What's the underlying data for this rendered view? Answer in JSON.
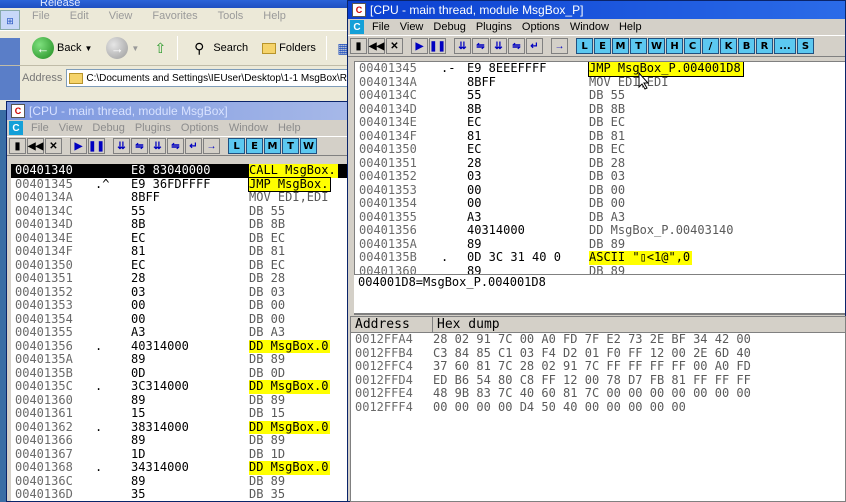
{
  "explorer": {
    "title": "Release",
    "menu": [
      "File",
      "Edit",
      "View",
      "Favorites",
      "Tools",
      "Help"
    ],
    "back_label": "Back",
    "search_label": "Search",
    "folders_label": "Folders",
    "address_label": "Address",
    "address_value": "C:\\Documents and Settings\\IEUser\\Desktop\\1-1 MsgBox\\Re"
  },
  "olly_left": {
    "title": "[CPU - main thread, module MsgBox]",
    "menu": [
      "File",
      "View",
      "Debug",
      "Plugins",
      "Options",
      "Window",
      "Help"
    ],
    "toolbar_letters": [
      "L",
      "E",
      "M",
      "T",
      "W"
    ],
    "rows": [
      {
        "addr": "00401340",
        "sym": "$",
        "hex": "E8 83040000",
        "mnem": "CALL MsgBox.",
        "sel": true,
        "hl": true
      },
      {
        "addr": "00401345",
        "sym": ".^",
        "hex": "E9 36FDFFFF",
        "mnem": "JMP MsgBox.",
        "box": true,
        "hl": true
      },
      {
        "addr": "0040134A",
        "sym": "",
        "hex": "8BFF",
        "mnem": "MOV EDI,EDI"
      },
      {
        "addr": "0040134C",
        "sym": "",
        "hex": "55",
        "mnem": "DB 55"
      },
      {
        "addr": "0040134D",
        "sym": "",
        "hex": "8B",
        "mnem": "DB 8B"
      },
      {
        "addr": "0040134E",
        "sym": "",
        "hex": "EC",
        "mnem": "DB EC"
      },
      {
        "addr": "0040134F",
        "sym": "",
        "hex": "81",
        "mnem": "DB 81"
      },
      {
        "addr": "00401350",
        "sym": "",
        "hex": "EC",
        "mnem": "DB EC"
      },
      {
        "addr": "00401351",
        "sym": "",
        "hex": "28",
        "mnem": "DB 28"
      },
      {
        "addr": "00401352",
        "sym": "",
        "hex": "03",
        "mnem": "DB 03"
      },
      {
        "addr": "00401353",
        "sym": "",
        "hex": "00",
        "mnem": "DB 00"
      },
      {
        "addr": "00401354",
        "sym": "",
        "hex": "00",
        "mnem": "DB 00"
      },
      {
        "addr": "00401355",
        "sym": "",
        "hex": "A3",
        "mnem": "DB A3"
      },
      {
        "addr": "00401356",
        "sym": ".",
        "hex": "40314000",
        "mnem": "DD MsgBox.0",
        "hl": true
      },
      {
        "addr": "0040135A",
        "sym": "",
        "hex": "89",
        "mnem": "DB 89"
      },
      {
        "addr": "0040135B",
        "sym": "",
        "hex": "0D",
        "mnem": "DB 0D"
      },
      {
        "addr": "0040135C",
        "sym": ".",
        "hex": "3C314000",
        "mnem": "DD MsgBox.0",
        "hl": true
      },
      {
        "addr": "00401360",
        "sym": "",
        "hex": "89",
        "mnem": "DB 89"
      },
      {
        "addr": "00401361",
        "sym": "",
        "hex": "15",
        "mnem": "DB 15"
      },
      {
        "addr": "00401362",
        "sym": ".",
        "hex": "38314000",
        "mnem": "DD MsgBox.0",
        "hl": true
      },
      {
        "addr": "00401366",
        "sym": "",
        "hex": "89",
        "mnem": "DB 89"
      },
      {
        "addr": "00401367",
        "sym": "",
        "hex": "1D",
        "mnem": "DB 1D"
      },
      {
        "addr": "00401368",
        "sym": ".",
        "hex": "34314000",
        "mnem": "DD MsgBox.0",
        "hl": true
      },
      {
        "addr": "0040136C",
        "sym": "",
        "hex": "89",
        "mnem": "DB 89"
      },
      {
        "addr": "0040136D",
        "sym": "",
        "hex": "35",
        "mnem": "DB 35"
      }
    ]
  },
  "olly_right": {
    "title": "[CPU - main thread, module MsgBox_P]",
    "menu": [
      "File",
      "View",
      "Debug",
      "Plugins",
      "Options",
      "Window",
      "Help"
    ],
    "toolbar_letters": [
      "L",
      "E",
      "M",
      "T",
      "W",
      "H",
      "C",
      "/",
      "K",
      "B",
      "R",
      "...",
      "S"
    ],
    "rows": [
      {
        "addr": "00401345",
        "sym": ".-",
        "hex": "E9 8EEEFFFF",
        "mnem": "JMP MsgBox_P.004001D8",
        "hl": true,
        "box": true
      },
      {
        "addr": "0040134A",
        "sym": "",
        "hex": "8BFF",
        "mnem": "MOV EDI,EDI"
      },
      {
        "addr": "0040134C",
        "sym": "",
        "hex": "55",
        "mnem": "DB 55"
      },
      {
        "addr": "0040134D",
        "sym": "",
        "hex": "8B",
        "mnem": "DB 8B"
      },
      {
        "addr": "0040134E",
        "sym": "",
        "hex": "EC",
        "mnem": "DB EC"
      },
      {
        "addr": "0040134F",
        "sym": "",
        "hex": "81",
        "mnem": "DB 81"
      },
      {
        "addr": "00401350",
        "sym": "",
        "hex": "EC",
        "mnem": "DB EC"
      },
      {
        "addr": "00401351",
        "sym": "",
        "hex": "28",
        "mnem": "DB 28"
      },
      {
        "addr": "00401352",
        "sym": "",
        "hex": "03",
        "mnem": "DB 03"
      },
      {
        "addr": "00401353",
        "sym": "",
        "hex": "00",
        "mnem": "DB 00"
      },
      {
        "addr": "00401354",
        "sym": "",
        "hex": "00",
        "mnem": "DB 00"
      },
      {
        "addr": "00401355",
        "sym": "",
        "hex": "A3",
        "mnem": "DB A3"
      },
      {
        "addr": "00401356",
        "sym": "",
        "hex": "40314000",
        "mnem": "DD MsgBox_P.00403140"
      },
      {
        "addr": "0040135A",
        "sym": "",
        "hex": "89",
        "mnem": "DB 89"
      },
      {
        "addr": "0040135B",
        "sym": ".",
        "hex": "0D 3C 31 40 0",
        "mnem": "ASCII \"▯<1@\",0",
        "hl": true
      },
      {
        "addr": "00401360",
        "sym": "",
        "hex": "89",
        "mnem": "DB 89"
      }
    ],
    "info_text": "004001D8=MsgBox_P.004001D8",
    "dump_headers": [
      "Address",
      "Hex dump"
    ],
    "dump_rows": [
      {
        "addr": "0012FFA4",
        "hex": "28 02 91 7C 00 A0 FD 7F E2 73 2E BF 34 42 00"
      },
      {
        "addr": "0012FFB4",
        "hex": "C3 84 85 C1 03 F4 D2 01 F0 FF 12 00 2E 6D 40"
      },
      {
        "addr": "0012FFC4",
        "hex": "37 60 81 7C 28 02 91 7C FF FF FF FF 00 A0 FD"
      },
      {
        "addr": "0012FFD4",
        "hex": "ED B6 54 80 C8 FF 12 00 78 D7 FB 81 FF FF FF"
      },
      {
        "addr": "0012FFE4",
        "hex": "48 9B 83 7C 40 60 81 7C 00 00 00 00 00 00 00"
      },
      {
        "addr": "0012FFF4",
        "hex": "00 00 00 00 D4 50 40 00 00 00 00 00"
      }
    ]
  }
}
